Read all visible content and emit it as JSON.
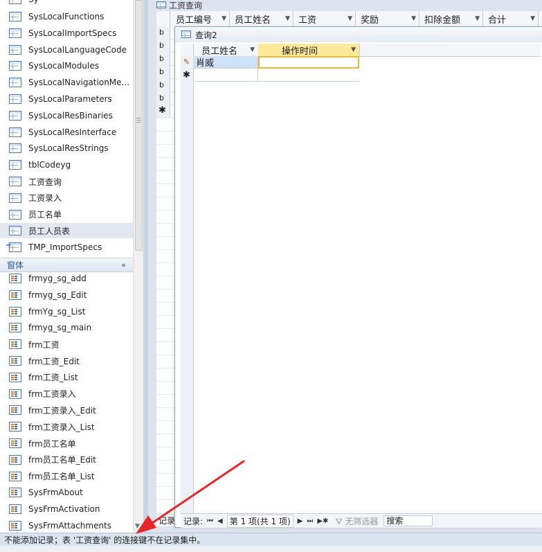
{
  "nav_pane": {
    "top_cut_item": "Sy",
    "tables": [
      {
        "label": "SysLocalFunctions",
        "icon": "table-icon"
      },
      {
        "label": "SysLocalImportSpecs",
        "icon": "table-icon"
      },
      {
        "label": "SysLocalLanguageCode",
        "icon": "table-icon"
      },
      {
        "label": "SysLocalModules",
        "icon": "table-icon"
      },
      {
        "label": "SysLocalNavigationMe...",
        "icon": "table-icon"
      },
      {
        "label": "SysLocalParameters",
        "icon": "table-icon"
      },
      {
        "label": "SysLocalResBinaries",
        "icon": "table-icon"
      },
      {
        "label": "SysLocalResInterface",
        "icon": "table-icon"
      },
      {
        "label": "SysLocalResStrings",
        "icon": "table-icon"
      },
      {
        "label": "tblCodeyg",
        "icon": "table-icon"
      },
      {
        "label": "工资查询",
        "icon": "table-icon"
      },
      {
        "label": "工资录入",
        "icon": "table-icon"
      },
      {
        "label": "员工名单",
        "icon": "table-icon"
      },
      {
        "label": "员工人员表",
        "icon": "table-icon",
        "selected": true
      },
      {
        "label": "TMP_ImportSpecs",
        "icon": "linked-table-icon"
      }
    ],
    "forms_group": {
      "title": "窗体",
      "collapse_glyph": "«"
    },
    "forms": [
      {
        "label": "frmyg_sg_add"
      },
      {
        "label": "frmyg_sg_Edit"
      },
      {
        "label": "frmYg_sg_List"
      },
      {
        "label": "frmyg_sg_main"
      },
      {
        "label": "frm工资"
      },
      {
        "label": "frm工资_Edit"
      },
      {
        "label": "frm工资_List"
      },
      {
        "label": "frm工资录入"
      },
      {
        "label": "frm工资录入_Edit"
      },
      {
        "label": "frm工资录入_List"
      },
      {
        "label": "frm员工名单"
      },
      {
        "label": "frm员工名单_Edit"
      },
      {
        "label": "frm员工名单_List"
      },
      {
        "label": "SysFrmAbout"
      },
      {
        "label": "SysFrmActivation"
      },
      {
        "label": "SysFrmAttachments"
      }
    ]
  },
  "background_form": {
    "title": "工资查询",
    "columns": [
      {
        "label": "员工编号"
      },
      {
        "label": "员工姓名"
      },
      {
        "label": "工资"
      },
      {
        "label": "奖励"
      },
      {
        "label": "扣除金额"
      },
      {
        "label": "合计"
      }
    ],
    "row_chars": [
      "b",
      "b",
      "b",
      "b",
      "b",
      "b"
    ],
    "new_row_marker": "✱",
    "record_nav_label": "记录"
  },
  "query_window": {
    "title": "查询2",
    "columns": [
      {
        "label": "员工姓名"
      },
      {
        "label": "操作时间"
      }
    ],
    "rows": [
      {
        "name": "肖威",
        "time": ""
      }
    ],
    "new_row_marker": "✱",
    "record_nav": {
      "label": "记录:",
      "first": "⏮",
      "prev": "◀",
      "position": "第 1 项(共 1 项)",
      "next": "▶",
      "last": "⏭",
      "new": "▶✱",
      "filter": "无筛选器",
      "search_placeholder": "搜索"
    }
  },
  "status_bar": {
    "message": "不能添加记录；表 '工资查询' 的连接键不在记录集中。"
  },
  "colors": {
    "accent": "#2b579a",
    "annotation_arrow": "#e8262a",
    "active_column": "#fde99a"
  }
}
